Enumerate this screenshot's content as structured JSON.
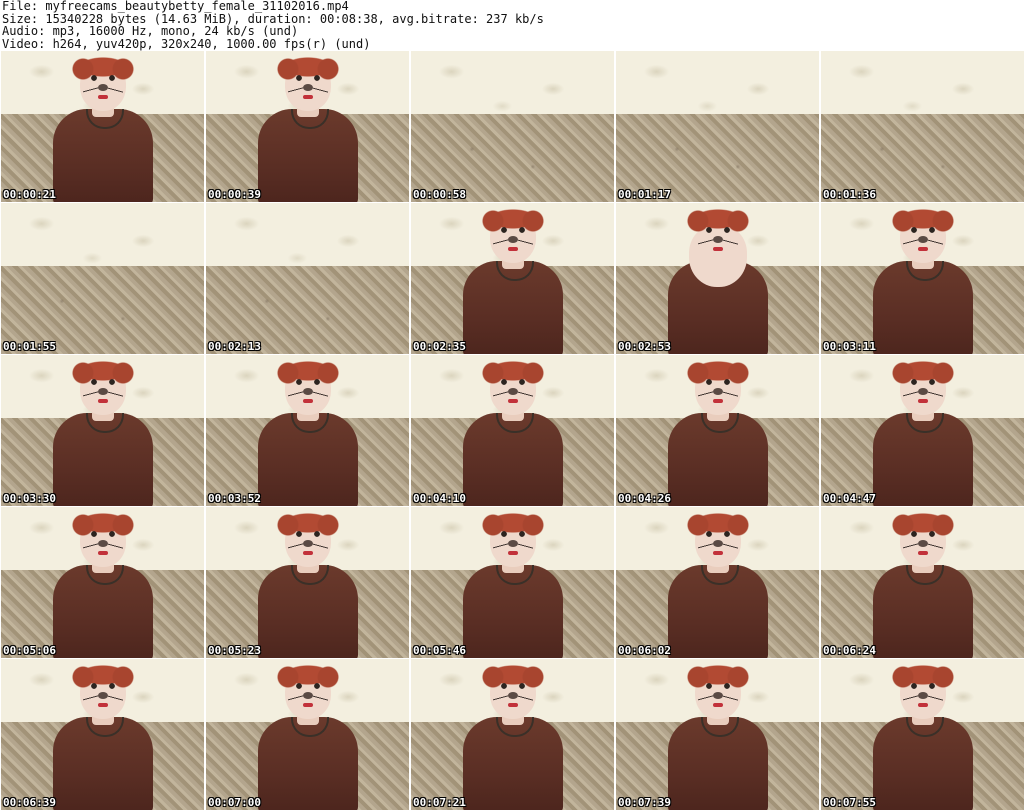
{
  "header": {
    "file": "File: myfreecams_beautybetty_female_31102016.mp4",
    "size": "Size: 15340228 bytes (14.63 MiB), duration: 00:08:38, avg.bitrate: 237 kb/s",
    "audio": "Audio: mp3, 16000 Hz, mono, 24 kb/s (und)",
    "video": "Video: h264, yuv420p, 320x240, 1000.00 fps(r) (und)"
  },
  "thumbnails": [
    {
      "time": "00:00:21",
      "person": true
    },
    {
      "time": "00:00:39",
      "person": true
    },
    {
      "time": "00:00:58",
      "person": false
    },
    {
      "time": "00:01:17",
      "person": false
    },
    {
      "time": "00:01:36",
      "person": false
    },
    {
      "time": "00:01:55",
      "person": false
    },
    {
      "time": "00:02:13",
      "person": false
    },
    {
      "time": "00:02:35",
      "person": true
    },
    {
      "time": "00:02:53",
      "person": true,
      "close": true
    },
    {
      "time": "00:03:11",
      "person": true
    },
    {
      "time": "00:03:30",
      "person": true
    },
    {
      "time": "00:03:52",
      "person": true
    },
    {
      "time": "00:04:10",
      "person": true
    },
    {
      "time": "00:04:26",
      "person": true
    },
    {
      "time": "00:04:47",
      "person": true
    },
    {
      "time": "00:05:06",
      "person": true
    },
    {
      "time": "00:05:23",
      "person": true
    },
    {
      "time": "00:05:46",
      "person": true
    },
    {
      "time": "00:06:02",
      "person": true
    },
    {
      "time": "00:06:24",
      "person": true
    },
    {
      "time": "00:06:39",
      "person": true
    },
    {
      "time": "00:07:00",
      "person": true
    },
    {
      "time": "00:07:21",
      "person": true
    },
    {
      "time": "00:07:39",
      "person": true
    },
    {
      "time": "00:07:55",
      "person": true
    }
  ]
}
